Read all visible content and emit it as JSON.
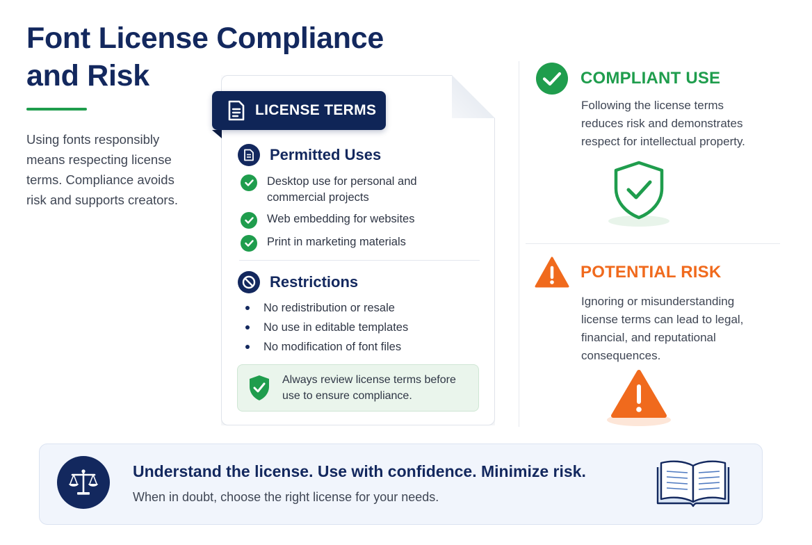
{
  "header": {
    "title": "Font License Compliance and Risk",
    "intro": "Using fonts responsibly means respecting license terms. Compliance avoids risk and supports creators."
  },
  "license_card": {
    "tab_label": "LICENSE TERMS",
    "tab_icon": "document-icon",
    "permitted": {
      "title": "Permitted Uses",
      "icon": "document-icon",
      "items": [
        "Desktop use for personal and commercial projects",
        "Web embedding for websites",
        "Print in marketing materials"
      ]
    },
    "restrictions": {
      "title": "Restrictions",
      "icon": "prohibited-icon",
      "items": [
        "No redistribution or resale",
        "No use in editable templates",
        "No modification of font files"
      ]
    },
    "review_note": "Always review license terms before use to ensure compliance."
  },
  "compliant": {
    "title": "COMPLIANT USE",
    "description": "Following the license terms reduces risk and demonstrates respect for intellectual property.",
    "icon": "check-circle-icon",
    "illustration": "shield-check-icon",
    "color": "#1f9d4d"
  },
  "risk": {
    "title": "POTENTIAL RISK",
    "description": "Ignoring or misunderstanding license terms can lead to legal, financial, and reputational consequences.",
    "icon": "warning-triangle-icon",
    "illustration": "warning-triangle-icon",
    "color": "#f06a1d"
  },
  "banner": {
    "headline": "Understand the license. Use with confidence. Minimize risk.",
    "subline": "When in doubt, choose the right license for your needs.",
    "left_icon": "scales-icon",
    "right_icon": "open-book-icon"
  },
  "colors": {
    "navy": "#13285e",
    "green": "#1f9d4d",
    "orange": "#f06a1d"
  }
}
